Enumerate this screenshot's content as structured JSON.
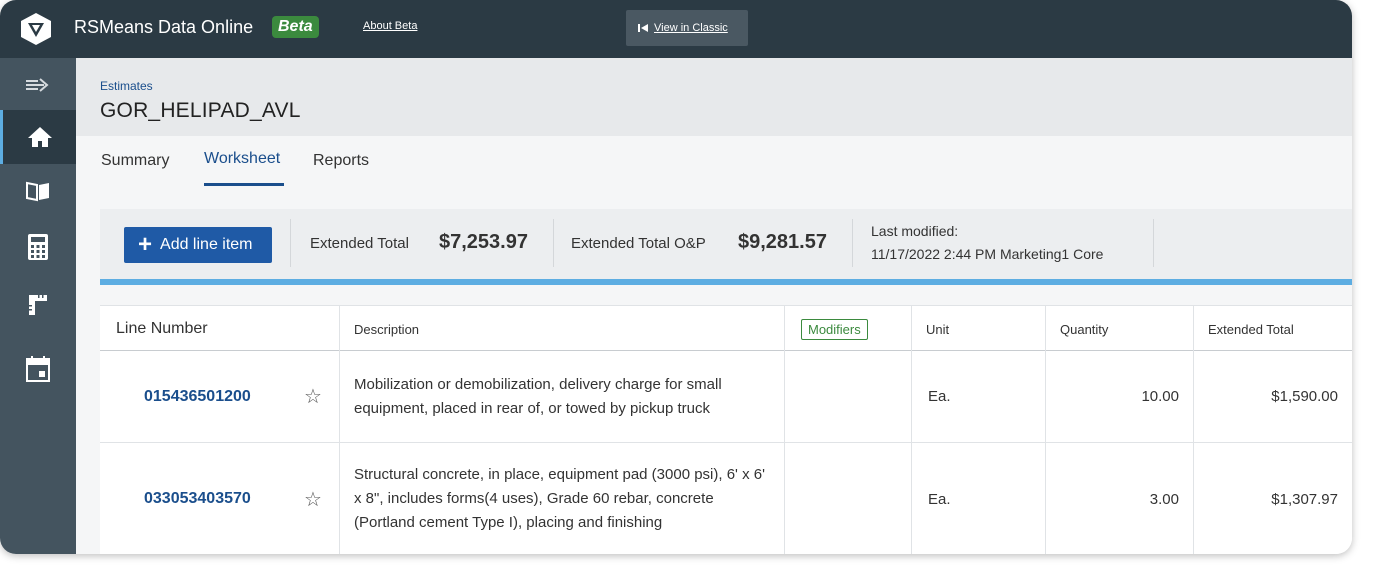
{
  "app": {
    "title": "RSMeans Data Online",
    "beta_badge": "Beta",
    "about_beta": "About Beta",
    "view_classic": "View in Classic"
  },
  "sidebar": {
    "items": [
      {
        "icon": "expand-arrow-icon",
        "active": false
      },
      {
        "icon": "home-icon",
        "active": true
      },
      {
        "icon": "book-icon",
        "active": false
      },
      {
        "icon": "calculator-icon",
        "active": false
      },
      {
        "icon": "ruler-icon",
        "active": false
      },
      {
        "icon": "calendar-icon",
        "active": false
      }
    ]
  },
  "header": {
    "breadcrumb": "Estimates",
    "title": "GOR_HELIPAD_AVL"
  },
  "tabs": [
    {
      "label": "Summary",
      "active": false
    },
    {
      "label": "Worksheet",
      "active": true
    },
    {
      "label": "Reports",
      "active": false
    }
  ],
  "toolbar": {
    "add_label": "Add line item",
    "extended_total_label": "Extended Total",
    "extended_total_value": "$7,253.97",
    "extended_total_op_label": "Extended Total O&P",
    "extended_total_op_value": "$9,281.57",
    "last_modified_label": "Last modified:",
    "last_modified_value": "11/17/2022 2:44 PM Marketing1 Core"
  },
  "table": {
    "headers": {
      "line_number": "Line Number",
      "description": "Description",
      "modifiers": "Modifiers",
      "unit": "Unit",
      "quantity": "Quantity",
      "extended_total": "Extended Total"
    },
    "rows": [
      {
        "line_number": "015436501200",
        "description": "Mobilization or demobilization, delivery charge for small equipment, placed in rear of, or towed by pickup truck",
        "unit": "Ea.",
        "quantity": "10.00",
        "extended_total": "$1,590.00"
      },
      {
        "line_number": "033053403570",
        "description": "Structural concrete, in place, equipment pad (3000 psi), 6' x 6' x 8\", includes forms(4 uses), Grade 60 rebar, concrete (Portland cement Type I), placing and finishing",
        "unit": "Ea.",
        "quantity": "3.00",
        "extended_total": "$1,307.97"
      }
    ]
  },
  "colors": {
    "topbar": "#2b3a44",
    "sidebar": "#44545f",
    "accent_blue": "#1f5aa6",
    "link_blue": "#1a4e8c",
    "beta_green": "#3b8a3e",
    "stripe_blue": "#5dade2"
  }
}
